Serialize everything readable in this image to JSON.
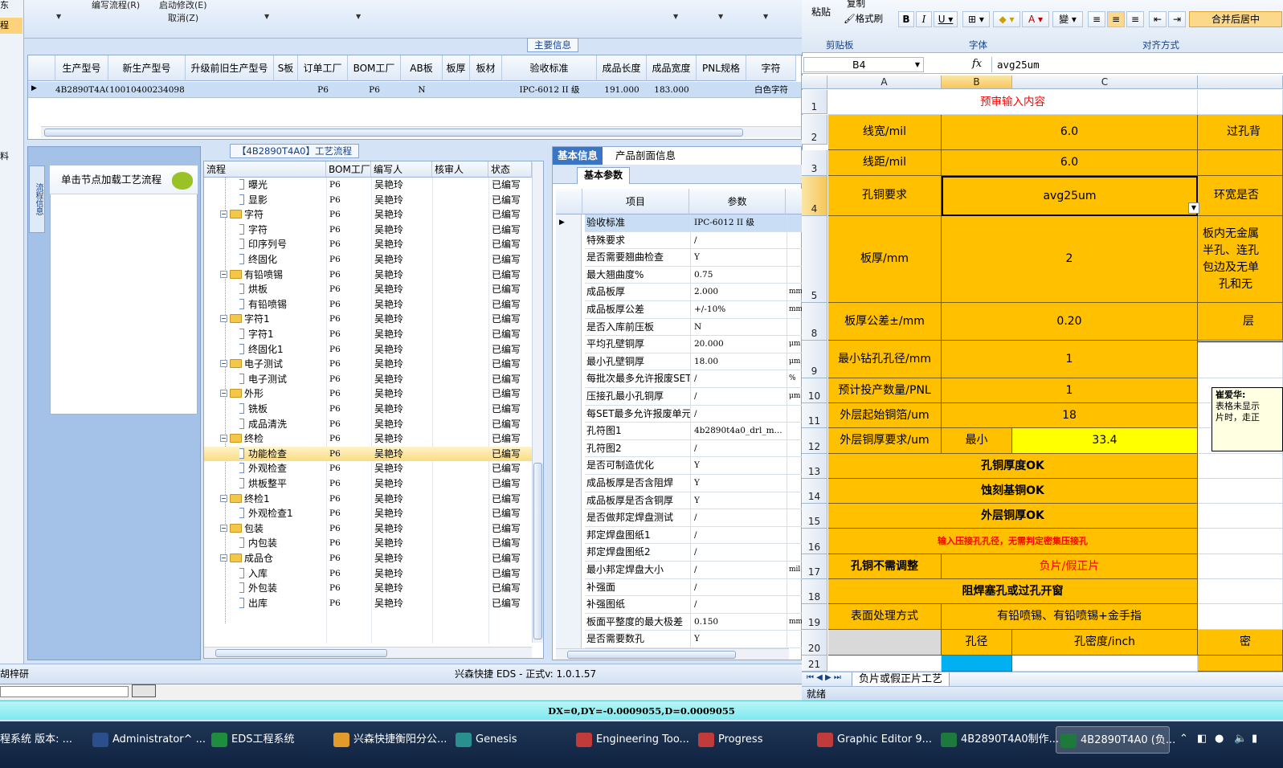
{
  "eds": {
    "menu": {
      "edit_flow": "编写流程(R)",
      "start_modify": "启动修改(E)",
      "cancel": "取消(Z)"
    },
    "left_strip": {
      "item1": "东",
      "item2": "程",
      "item3": "料"
    },
    "main_info_caption": "主要信息",
    "main_grid": {
      "columns": [
        "生产型号",
        "新生产型号",
        "升级前旧生产型号",
        "S板",
        "订单工厂",
        "BOM工厂",
        "AB板",
        "板厚",
        "板材",
        "验收标准",
        "成品长度",
        "成品宽度",
        "PNL规格",
        "字符"
      ],
      "row": [
        "4B2890T4A0",
        "10010400234098",
        "",
        "",
        "P6",
        "P6",
        "N",
        "",
        "",
        "IPC-6012 II 级",
        "191.000",
        "183.000",
        "",
        "白色字符"
      ]
    },
    "flow_caption": "【4B2890T4A0】工艺流程",
    "side_tab": "流程信息",
    "load_flow_label": "单击节点加载工艺流程",
    "tree": {
      "headers": [
        "流程",
        "BOM工厂",
        "编写人",
        "核审人",
        "状态"
      ],
      "rows": [
        {
          "name": "曝光",
          "type": "leaf",
          "factory": "P6",
          "writer": "吴艳玲",
          "reviewer": "",
          "status": "已编写"
        },
        {
          "name": "显影",
          "type": "leaf",
          "factory": "P6",
          "writer": "吴艳玲",
          "reviewer": "",
          "status": "已编写"
        },
        {
          "name": "字符",
          "type": "folder",
          "factory": "P6",
          "writer": "吴艳玲",
          "reviewer": "",
          "status": "已编写"
        },
        {
          "name": "字符",
          "type": "leaf",
          "factory": "P6",
          "writer": "吴艳玲",
          "reviewer": "",
          "status": "已编写"
        },
        {
          "name": "印序列号",
          "type": "leaf",
          "factory": "P6",
          "writer": "吴艳玲",
          "reviewer": "",
          "status": "已编写"
        },
        {
          "name": "终固化",
          "type": "leaf",
          "factory": "P6",
          "writer": "吴艳玲",
          "reviewer": "",
          "status": "已编写"
        },
        {
          "name": "有铅喷锡",
          "type": "folder",
          "factory": "P6",
          "writer": "吴艳玲",
          "reviewer": "",
          "status": "已编写"
        },
        {
          "name": "烘板",
          "type": "leaf",
          "factory": "P6",
          "writer": "吴艳玲",
          "reviewer": "",
          "status": "已编写"
        },
        {
          "name": "有铅喷锡",
          "type": "leaf",
          "factory": "P6",
          "writer": "吴艳玲",
          "reviewer": "",
          "status": "已编写"
        },
        {
          "name": "字符1",
          "type": "folder",
          "factory": "P6",
          "writer": "吴艳玲",
          "reviewer": "",
          "status": "已编写"
        },
        {
          "name": "字符1",
          "type": "leaf",
          "factory": "P6",
          "writer": "吴艳玲",
          "reviewer": "",
          "status": "已编写"
        },
        {
          "name": "终固化1",
          "type": "leaf",
          "factory": "P6",
          "writer": "吴艳玲",
          "reviewer": "",
          "status": "已编写"
        },
        {
          "name": "电子测试",
          "type": "folder",
          "factory": "P6",
          "writer": "吴艳玲",
          "reviewer": "",
          "status": "已编写"
        },
        {
          "name": "电子测试",
          "type": "leaf",
          "factory": "P6",
          "writer": "吴艳玲",
          "reviewer": "",
          "status": "已编写"
        },
        {
          "name": "外形",
          "type": "folder",
          "factory": "P6",
          "writer": "吴艳玲",
          "reviewer": "",
          "status": "已编写"
        },
        {
          "name": "铣板",
          "type": "leaf",
          "factory": "P6",
          "writer": "吴艳玲",
          "reviewer": "",
          "status": "已编写"
        },
        {
          "name": "成品清洗",
          "type": "leaf",
          "factory": "P6",
          "writer": "吴艳玲",
          "reviewer": "",
          "status": "已编写"
        },
        {
          "name": "终检",
          "type": "folder",
          "factory": "P6",
          "writer": "吴艳玲",
          "reviewer": "",
          "status": "已编写"
        },
        {
          "name": "功能检查",
          "type": "leaf",
          "factory": "P6",
          "writer": "吴艳玲",
          "reviewer": "",
          "status": "已编写",
          "selected": true
        },
        {
          "name": "外观检查",
          "type": "leaf",
          "factory": "P6",
          "writer": "吴艳玲",
          "reviewer": "",
          "status": "已编写"
        },
        {
          "name": "烘板整平",
          "type": "leaf",
          "factory": "P6",
          "writer": "吴艳玲",
          "reviewer": "",
          "status": "已编写"
        },
        {
          "name": "终检1",
          "type": "folder",
          "factory": "P6",
          "writer": "吴艳玲",
          "reviewer": "",
          "status": "已编写"
        },
        {
          "name": "外观检查1",
          "type": "leaf",
          "factory": "P6",
          "writer": "吴艳玲",
          "reviewer": "",
          "status": "已编写"
        },
        {
          "name": "包装",
          "type": "folder",
          "factory": "P6",
          "writer": "吴艳玲",
          "reviewer": "",
          "status": "已编写"
        },
        {
          "name": "内包装",
          "type": "leaf",
          "factory": "P6",
          "writer": "吴艳玲",
          "reviewer": "",
          "status": "已编写"
        },
        {
          "name": "成品仓",
          "type": "folder",
          "factory": "P6",
          "writer": "吴艳玲",
          "reviewer": "",
          "status": "已编写"
        },
        {
          "name": "入库",
          "type": "leaf",
          "factory": "P6",
          "writer": "吴艳玲",
          "reviewer": "",
          "status": "已编写"
        },
        {
          "name": "外包装",
          "type": "leaf",
          "factory": "P6",
          "writer": "吴艳玲",
          "reviewer": "",
          "status": "已编写"
        },
        {
          "name": "出库",
          "type": "leaf",
          "factory": "P6",
          "writer": "吴艳玲",
          "reviewer": "",
          "status": "已编写"
        }
      ]
    },
    "info_tabs": [
      "基本信息",
      "产品剖面信息"
    ],
    "subtab": "基本参数",
    "info_headers": [
      "项目",
      "参数"
    ],
    "info_rows": [
      {
        "item": "验收标准",
        "value": "IPC-6012 II 级",
        "unit": ""
      },
      {
        "item": "特殊要求",
        "value": "/",
        "unit": ""
      },
      {
        "item": "是否需要翘曲检查",
        "value": "Y",
        "unit": ""
      },
      {
        "item": "最大翘曲度%",
        "value": "0.75",
        "unit": ""
      },
      {
        "item": "成品板厚",
        "value": "2.000",
        "unit": "mm"
      },
      {
        "item": "成品板厚公差",
        "value": "+/-10%",
        "unit": "mm"
      },
      {
        "item": "是否入库前压板",
        "value": "N",
        "unit": ""
      },
      {
        "item": "平均孔壁铜厚",
        "value": "20.000",
        "unit": "μm"
      },
      {
        "item": "最小孔壁铜厚",
        "value": "18.00",
        "unit": "μm"
      },
      {
        "item": "每批次最多允许报废SET",
        "value": "/",
        "unit": "%"
      },
      {
        "item": "压接孔最小孔铜厚",
        "value": "/",
        "unit": "μm"
      },
      {
        "item": "每SET最多允许报废单元",
        "value": "/",
        "unit": ""
      },
      {
        "item": "孔符图1",
        "value": "4b2890t4a0_drl_m...",
        "unit": ""
      },
      {
        "item": "孔符图2",
        "value": "/",
        "unit": ""
      },
      {
        "item": "是否可制造优化",
        "value": "Y",
        "unit": ""
      },
      {
        "item": "成品板厚是否含阻焊",
        "value": "Y",
        "unit": ""
      },
      {
        "item": "成品板厚是否含铜厚",
        "value": "Y",
        "unit": ""
      },
      {
        "item": "是否做邦定焊盘测试",
        "value": "/",
        "unit": ""
      },
      {
        "item": "邦定焊盘图纸1",
        "value": "/",
        "unit": ""
      },
      {
        "item": "邦定焊盘图纸2",
        "value": "/",
        "unit": ""
      },
      {
        "item": "最小邦定焊盘大小",
        "value": "/",
        "unit": "mil"
      },
      {
        "item": "补强面",
        "value": "/",
        "unit": ""
      },
      {
        "item": "补强图纸",
        "value": "/",
        "unit": ""
      },
      {
        "item": "板面平整度的最大极差",
        "value": "0.150",
        "unit": "mm/"
      },
      {
        "item": "是否需要数孔",
        "value": "Y",
        "unit": ""
      }
    ],
    "status_user": "胡梓研",
    "status_version": "兴森快捷 EDS - 正式v: 1.0.1.57"
  },
  "excel": {
    "clipboard": {
      "paste": "粘贴",
      "copy": "复制",
      "format_painter": "格式刷",
      "group": "剪贴板"
    },
    "font_group": "字体",
    "align_group": "对齐方式",
    "merge_center": "合并后居中",
    "name_box": "B4",
    "fx": "fx",
    "formula": "avg25um",
    "col_headers": [
      "A",
      "B",
      "C"
    ],
    "row_numbers": [
      "1",
      "2",
      "3",
      "4",
      "5",
      "8",
      "9",
      "10",
      "11",
      "12",
      "13",
      "14",
      "15",
      "16",
      "17",
      "18",
      "19",
      "20",
      "21"
    ],
    "cells": {
      "r1": "预审输入内容",
      "r2a": "线宽/mil",
      "r2b": "6.0",
      "r2d": "过孔背",
      "r3a": "线距/mil",
      "r3b": "6.0",
      "r3d": "",
      "r4a": "孔铜要求",
      "r4b": "avg25um",
      "r4d": "环宽是否",
      "r5a": "板厚/mm",
      "r5b": "2",
      "r5d1": "板内无金属",
      "r5d2": "半孔、连孔",
      "r5d3": "包边及无单",
      "r5d4": "孔和无",
      "r8a": "板厚公差±/mm",
      "r8b": "0.20",
      "r8d": "层",
      "r9a": "最小钻孔孔径/mm",
      "r9b": "1",
      "r10a": "预计投产数量/PNL",
      "r10b": "1",
      "r11a": "外层起始铜箔/um",
      "r11b": "18",
      "r12a": "外层铜厚要求/um",
      "r12b": "最小",
      "r12c": "33.4",
      "r13": "孔铜厚度OK",
      "r14": "蚀刻基铜OK",
      "r15": "外层铜厚OK",
      "r16": "输入压接孔孔径，无需判定密集压接孔",
      "r17a": "孔铜不需调整",
      "r17b": "负片/假正片",
      "r18": "阻焊塞孔或过孔开窗",
      "r19a": "表面处理方式",
      "r19b": "有铅喷锡、有铅喷锡+金手指",
      "r20b": "孔径",
      "r20c": "孔密度/inch",
      "r20d": "密",
      "comment_author": "崔爱华:",
      "comment_l1": "表格未显示",
      "comment_l2": "片时，走正"
    },
    "sheet_tab": "负片或假正片工艺",
    "status": "就绪"
  },
  "cyan_status": "DX=0,DY=-0.0009055,D=0.0009055",
  "taskbar": [
    {
      "label": "程系统  版本: ...",
      "color": "#3a6ea5"
    },
    {
      "label": "Administrator^ ...",
      "color": "#2b4f8c"
    },
    {
      "label": "EDS工程系统",
      "color": "#1e8e3e"
    },
    {
      "label": "兴森快捷衡阳分公...",
      "color": "#e39b2b"
    },
    {
      "label": "Genesis",
      "color": "#2a8f8f"
    },
    {
      "label": "Engineering Too...",
      "color": "#c23b3b"
    },
    {
      "label": "Progress",
      "color": "#c23b3b"
    },
    {
      "label": "Graphic Editor 9...",
      "color": "#c23b3b"
    },
    {
      "label": "4B2890T4A0制作...",
      "color": "#1d7a3c"
    },
    {
      "label": "4B2890T4A0 (负...",
      "color": "#1d7a3c",
      "active": true
    }
  ],
  "colors": {
    "accent_orange": "#ffc000",
    "yellow_cell": "#ffff00",
    "red_text": "#ff0000",
    "cyan_bar": "#7de9ee"
  }
}
